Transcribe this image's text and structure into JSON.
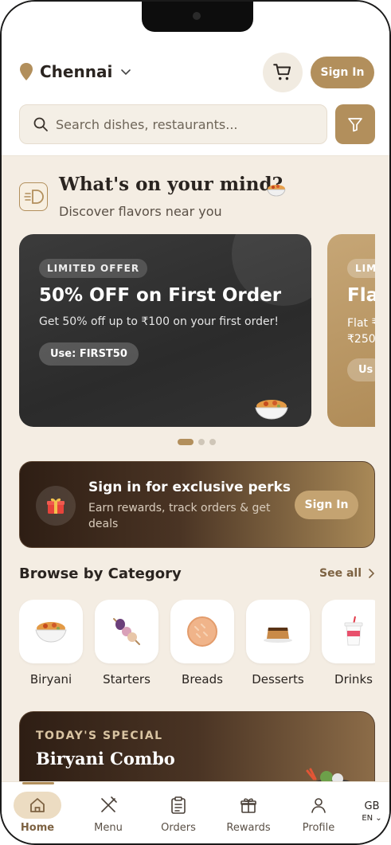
{
  "header": {
    "city": "Chennai",
    "sign_in_label": "Sign In",
    "search_placeholder": "Search dishes, restaurants..."
  },
  "mind": {
    "title": "What's on your mind?",
    "subtitle": "Discover flavors near you"
  },
  "offers": [
    {
      "badge": "LIMITED OFFER",
      "title": "50% OFF on First Order",
      "description": "Get 50% off up to ₹100 on your first order!",
      "code": "Use: FIRST50"
    },
    {
      "badge": "LIM",
      "title": "Fla",
      "description_line1": "Flat ₹",
      "description_line2": "₹250",
      "code": "Us"
    }
  ],
  "carousel": {
    "active_index": 0,
    "count": 3
  },
  "perks": {
    "title": "Sign in for exclusive perks",
    "description": "Earn rewards, track orders & get deals",
    "button_label": "Sign In"
  },
  "categories": {
    "title": "Browse by Category",
    "see_all": "See all",
    "items": [
      {
        "label": "Biryani",
        "icon": "biryani-icon"
      },
      {
        "label": "Starters",
        "icon": "skewer-icon"
      },
      {
        "label": "Breads",
        "icon": "bread-icon"
      },
      {
        "label": "Desserts",
        "icon": "pudding-icon"
      },
      {
        "label": "Drinks",
        "icon": "drink-icon"
      }
    ]
  },
  "special": {
    "label": "TODAY'S SPECIAL",
    "title": "Biryani Combo"
  },
  "nav": {
    "items": [
      {
        "label": "Home",
        "icon": "home-icon",
        "active": true
      },
      {
        "label": "Menu",
        "icon": "utensils-icon",
        "active": false
      },
      {
        "label": "Orders",
        "icon": "clipboard-icon",
        "active": false
      },
      {
        "label": "Rewards",
        "icon": "gift-icon",
        "active": false
      },
      {
        "label": "Profile",
        "icon": "user-icon",
        "active": false
      }
    ],
    "lang_flag": "GB",
    "lang_code": "EN"
  },
  "colors": {
    "accent": "#b28f5c",
    "background": "#f4ede3",
    "dark_card": "#2f2f2f"
  }
}
